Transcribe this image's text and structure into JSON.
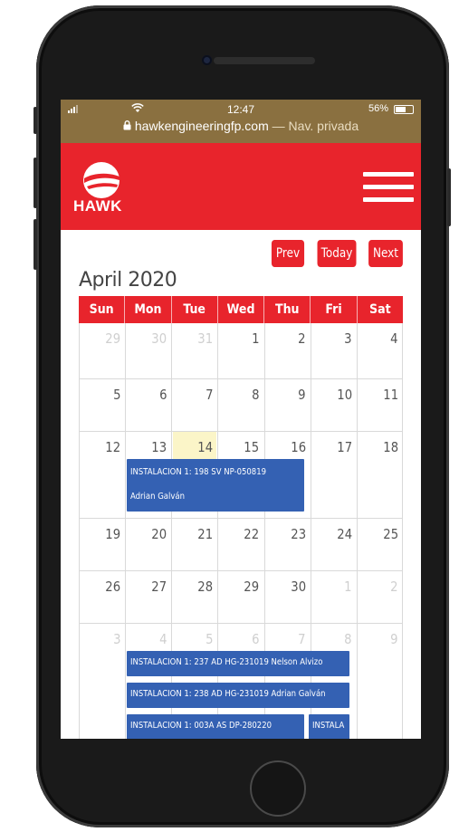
{
  "status_bar": {
    "time": "12:47",
    "battery": "56%",
    "url": "hawkengineeringfp.com",
    "private_label": "— Nav. privada"
  },
  "header": {
    "logo_text": "HAWK",
    "brand_color": "#e8242c"
  },
  "calendar": {
    "nav": {
      "prev": "Prev",
      "today": "Today",
      "next": "Next"
    },
    "month_title": "April 2020",
    "weekdays": [
      "Sun",
      "Mon",
      "Tue",
      "Wed",
      "Thu",
      "Fri",
      "Sat"
    ],
    "weeks": [
      {
        "days": [
          "29",
          "30",
          "31",
          "1",
          "2",
          "3",
          "4"
        ],
        "other": [
          true,
          true,
          true,
          false,
          false,
          false,
          false
        ]
      },
      {
        "days": [
          "5",
          "6",
          "7",
          "8",
          "9",
          "10",
          "11"
        ],
        "other": [
          false,
          false,
          false,
          false,
          false,
          false,
          false
        ]
      },
      {
        "days": [
          "12",
          "13",
          "14",
          "15",
          "16",
          "17",
          "18"
        ],
        "other": [
          false,
          false,
          false,
          false,
          false,
          false,
          false
        ]
      },
      {
        "days": [
          "19",
          "20",
          "21",
          "22",
          "23",
          "24",
          "25"
        ],
        "other": [
          false,
          false,
          false,
          false,
          false,
          false,
          false
        ]
      },
      {
        "days": [
          "26",
          "27",
          "28",
          "29",
          "30",
          "1",
          "2"
        ],
        "other": [
          false,
          false,
          false,
          false,
          false,
          true,
          true
        ]
      },
      {
        "days": [
          "3",
          "4",
          "5",
          "6",
          "7",
          "8",
          "9"
        ],
        "other": [
          true,
          true,
          true,
          true,
          true,
          true,
          true
        ]
      }
    ],
    "today": "14",
    "events": {
      "week3": {
        "line1": "INSTALACION 1: 198 SV NP-050819",
        "line2": "Adrian Galván"
      },
      "week6": [
        "INSTALACION 1: 237 AD HG-231019 Nelson Alvizo",
        "INSTALACION 1: 238 AD HG-231019 Adrian Galván",
        "INSTALACION 1: 003A AS DP-280220",
        "INSTALA"
      ]
    },
    "event_color": "#3461b3"
  }
}
